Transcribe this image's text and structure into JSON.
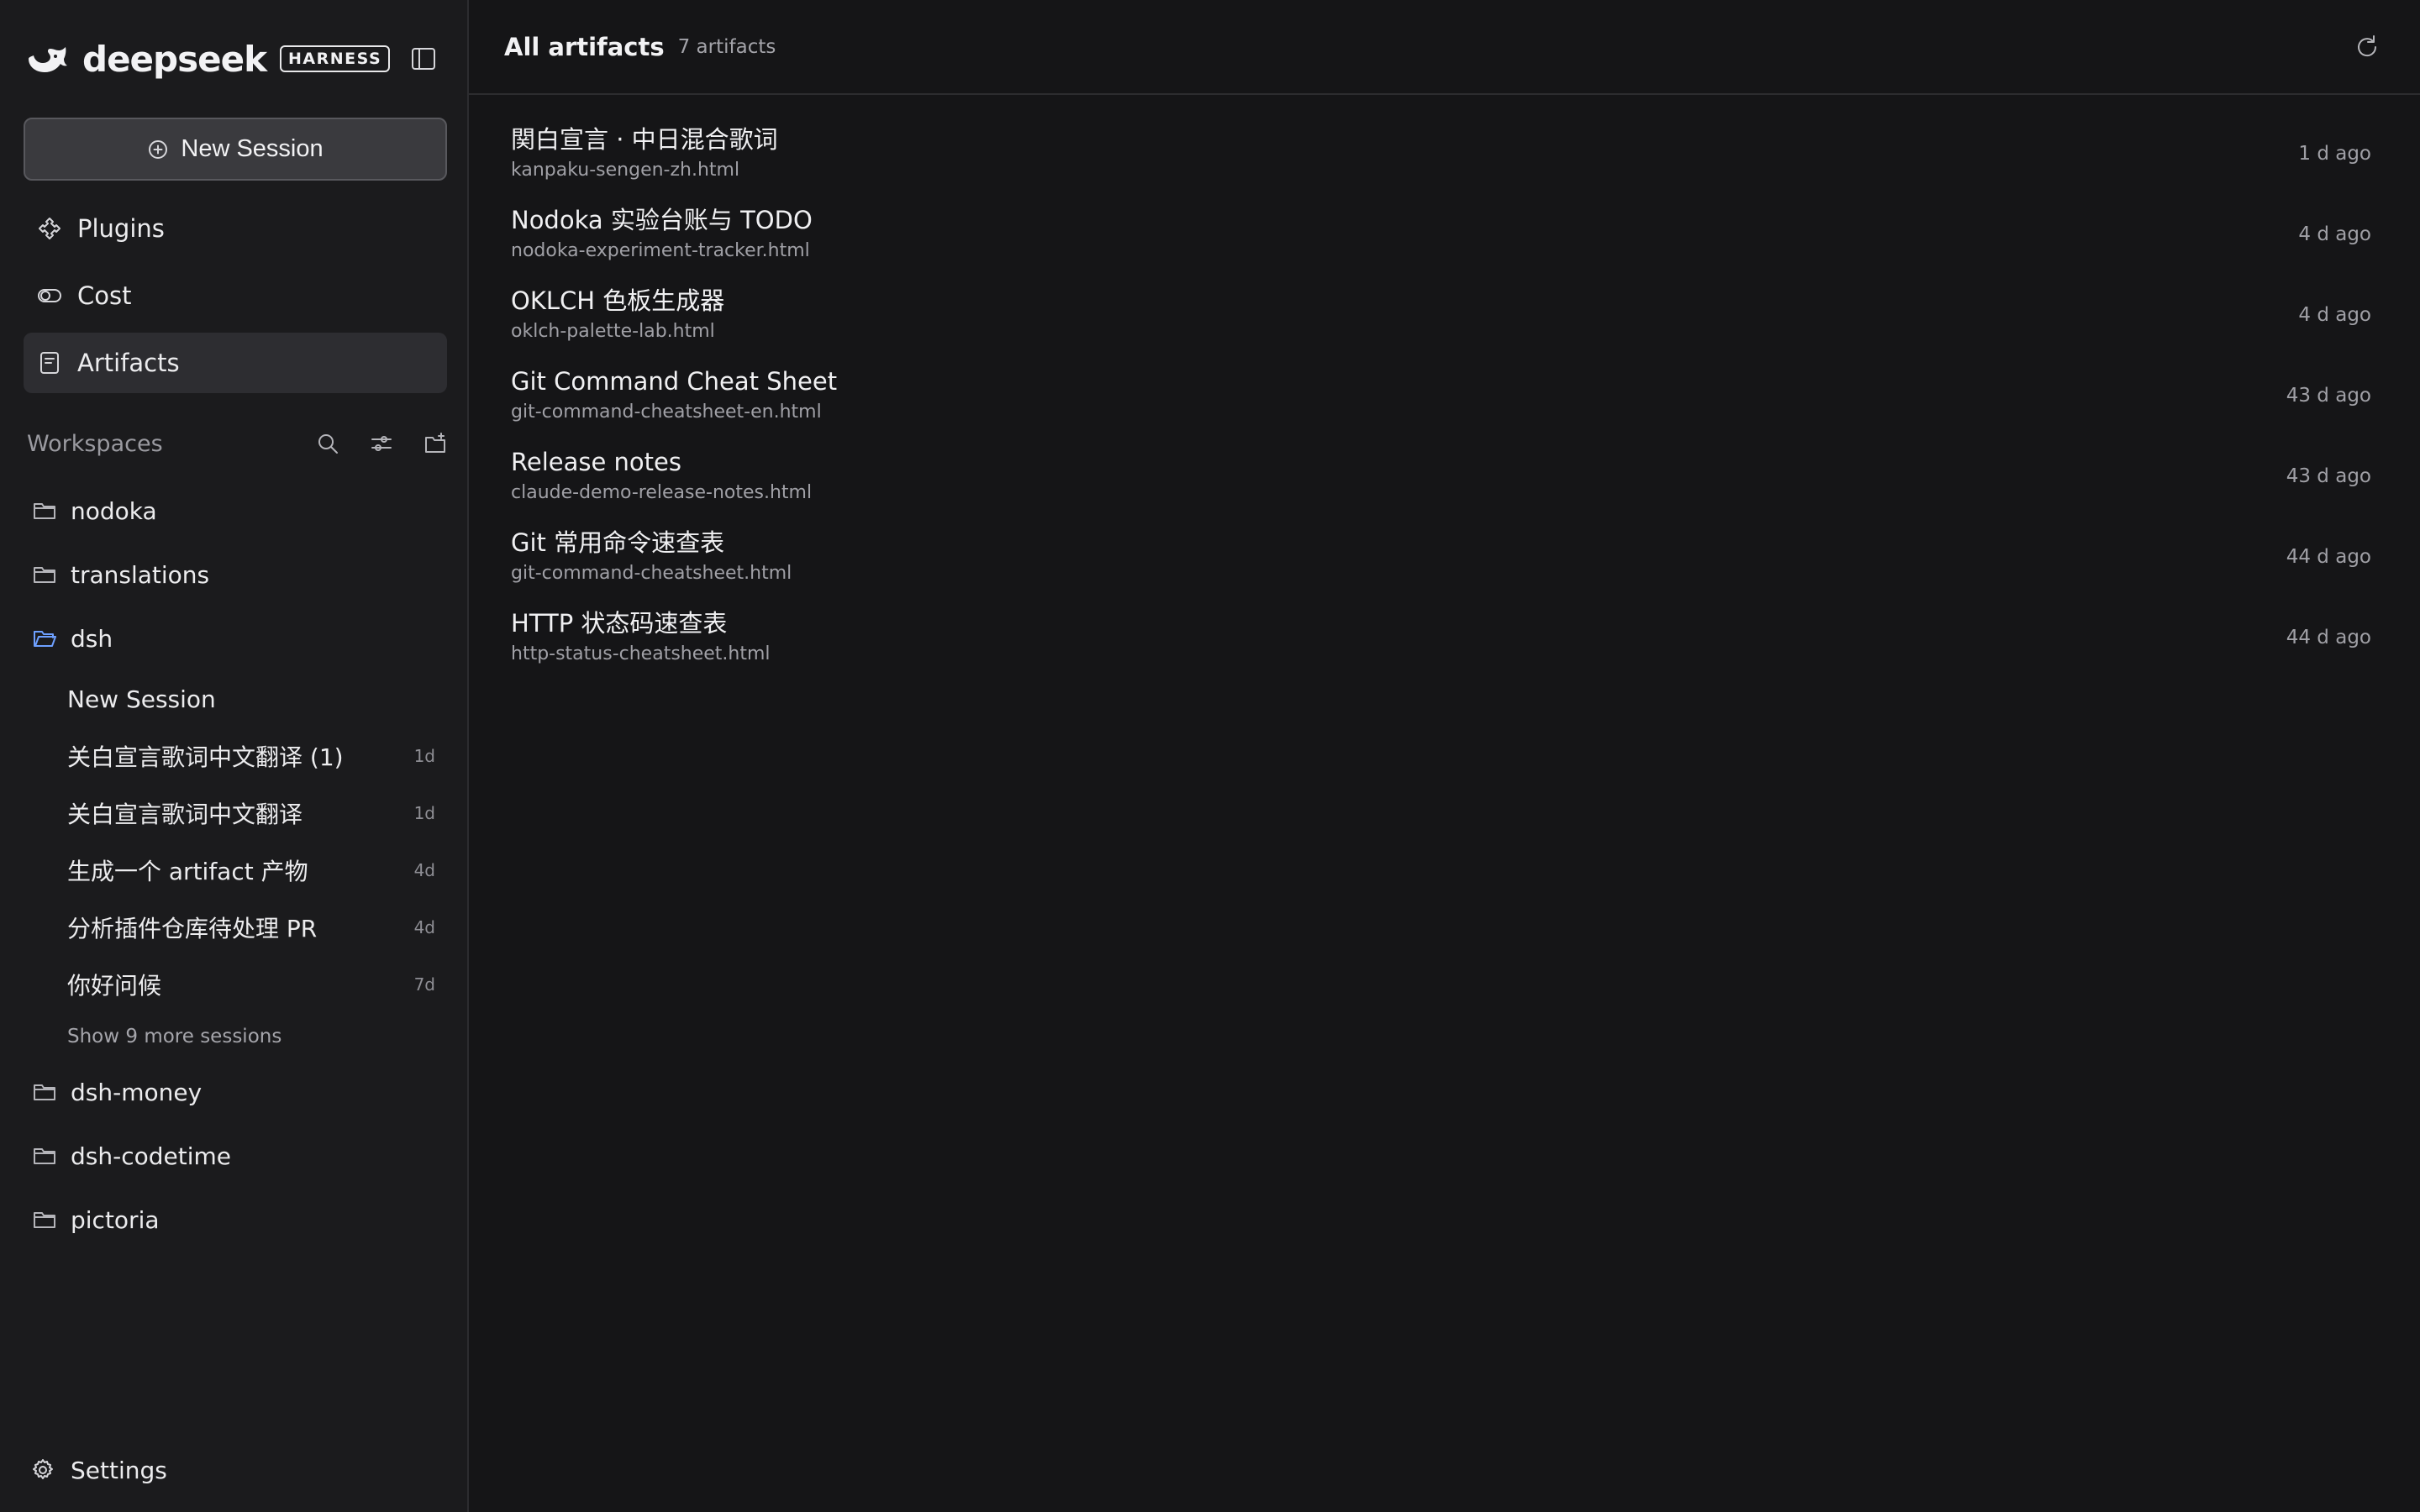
{
  "brand": {
    "wordmark": "deepseek",
    "badge": "HARNESS",
    "logo_icon": "whale-icon",
    "collapse_icon": "sidebar-toggle-icon"
  },
  "sidebar": {
    "new_session_label": "New Session",
    "nav": [
      {
        "label": "Plugins",
        "icon": "plugin-icon",
        "active": false
      },
      {
        "label": "Cost",
        "icon": "toggle-icon",
        "active": false
      },
      {
        "label": "Artifacts",
        "icon": "document-icon",
        "active": true
      }
    ],
    "workspaces_title": "Workspaces",
    "workspaces": [
      {
        "name": "nodoka",
        "open": false
      },
      {
        "name": "translations",
        "open": false
      },
      {
        "name": "dsh",
        "open": true,
        "sessions": [
          {
            "title": "New Session",
            "age": ""
          },
          {
            "title": "关白宣言歌词中文翻译 (1)",
            "age": "1d"
          },
          {
            "title": "关白宣言歌词中文翻译",
            "age": "1d"
          },
          {
            "title": "生成一个 artifact 产物",
            "age": "4d"
          },
          {
            "title": "分析插件仓库待处理 PR",
            "age": "4d"
          },
          {
            "title": "你好问候",
            "age": "7d"
          }
        ],
        "show_more": "Show 9 more sessions"
      },
      {
        "name": "dsh-money",
        "open": false
      },
      {
        "name": "dsh-codetime",
        "open": false
      },
      {
        "name": "pictoria",
        "open": false
      }
    ],
    "settings_label": "Settings"
  },
  "main": {
    "title": "All artifacts",
    "count": "7 artifacts",
    "artifacts": [
      {
        "title": "関白宣言 · 中日混合歌词",
        "file": "kanpaku-sengen-zh.html",
        "time": "1 d ago"
      },
      {
        "title": "Nodoka 实验台账与 TODO",
        "file": "nodoka-experiment-tracker.html",
        "time": "4 d ago"
      },
      {
        "title": "OKLCH 色板生成器",
        "file": "oklch-palette-lab.html",
        "time": "4 d ago"
      },
      {
        "title": "Git Command Cheat Sheet",
        "file": "git-command-cheatsheet-en.html",
        "time": "43 d ago"
      },
      {
        "title": "Release notes",
        "file": "claude-demo-release-notes.html",
        "time": "43 d ago"
      },
      {
        "title": "Git 常用命令速查表",
        "file": "git-command-cheatsheet.html",
        "time": "44 d ago"
      },
      {
        "title": "HTTP 状态码速查表",
        "file": "http-status-cheatsheet.html",
        "time": "44 d ago"
      }
    ]
  },
  "colors": {
    "background": "#151517",
    "sidebar": "#1b1b1d",
    "active_nav": "#2d2d31",
    "button": "#3a3a3e",
    "open_folder": "#6ea0ff"
  }
}
